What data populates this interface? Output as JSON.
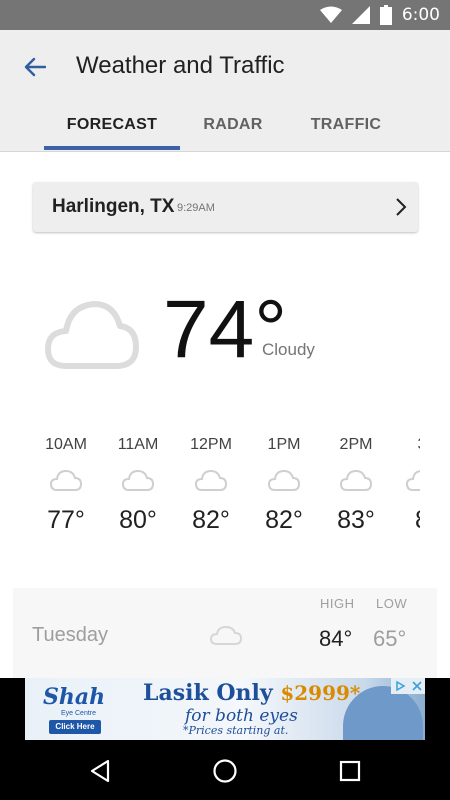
{
  "status_bar": {
    "time": "6:00",
    "icons": [
      "wifi-icon",
      "cellular-signal-icon",
      "battery-icon"
    ],
    "color": "#757575"
  },
  "app_bar": {
    "title": "Weather and Traffic",
    "back_icon": "arrow-left-icon",
    "tabs": [
      {
        "label": "FORECAST",
        "active": true
      },
      {
        "label": "RADAR",
        "active": false
      },
      {
        "label": "TRAFFIC",
        "active": false
      }
    ],
    "accent_color": "#3b62a8"
  },
  "location": {
    "city": "Harlingen, TX",
    "time": "9:29AM",
    "chevron_icon": "chevron-right-icon"
  },
  "current": {
    "temperature": "74°",
    "condition": "Cloudy",
    "icon": "cloud-icon"
  },
  "hourly": [
    {
      "time": "10AM",
      "temp": "77°",
      "icon": "cloud-icon"
    },
    {
      "time": "11AM",
      "temp": "80°",
      "icon": "cloud-icon"
    },
    {
      "time": "12PM",
      "temp": "82°",
      "icon": "cloud-icon"
    },
    {
      "time": "1PM",
      "temp": "82°",
      "icon": "cloud-icon"
    },
    {
      "time": "2PM",
      "temp": "83°",
      "icon": "cloud-icon"
    },
    {
      "time": "3",
      "temp": "8",
      "icon": "cloud-icon"
    }
  ],
  "daily": {
    "high_header": "HIGH",
    "low_header": "LOW",
    "rows": [
      {
        "day": "Tuesday",
        "high": "84°",
        "low": "65°",
        "icon": "cloud-icon"
      }
    ]
  },
  "ad": {
    "logo": "Shah",
    "logo_sub": "Eye Centre",
    "cta": "Click Here",
    "headline": "Lasik Only ",
    "price": "$2999*",
    "subline": "for both eyes",
    "fine_print": "*Prices starting at.",
    "badge_icons": [
      "ad-choices-icon",
      "close-icon"
    ]
  },
  "nav_bar": {
    "icons": [
      "back-triangle-icon",
      "home-circle-icon",
      "recents-square-icon"
    ]
  }
}
